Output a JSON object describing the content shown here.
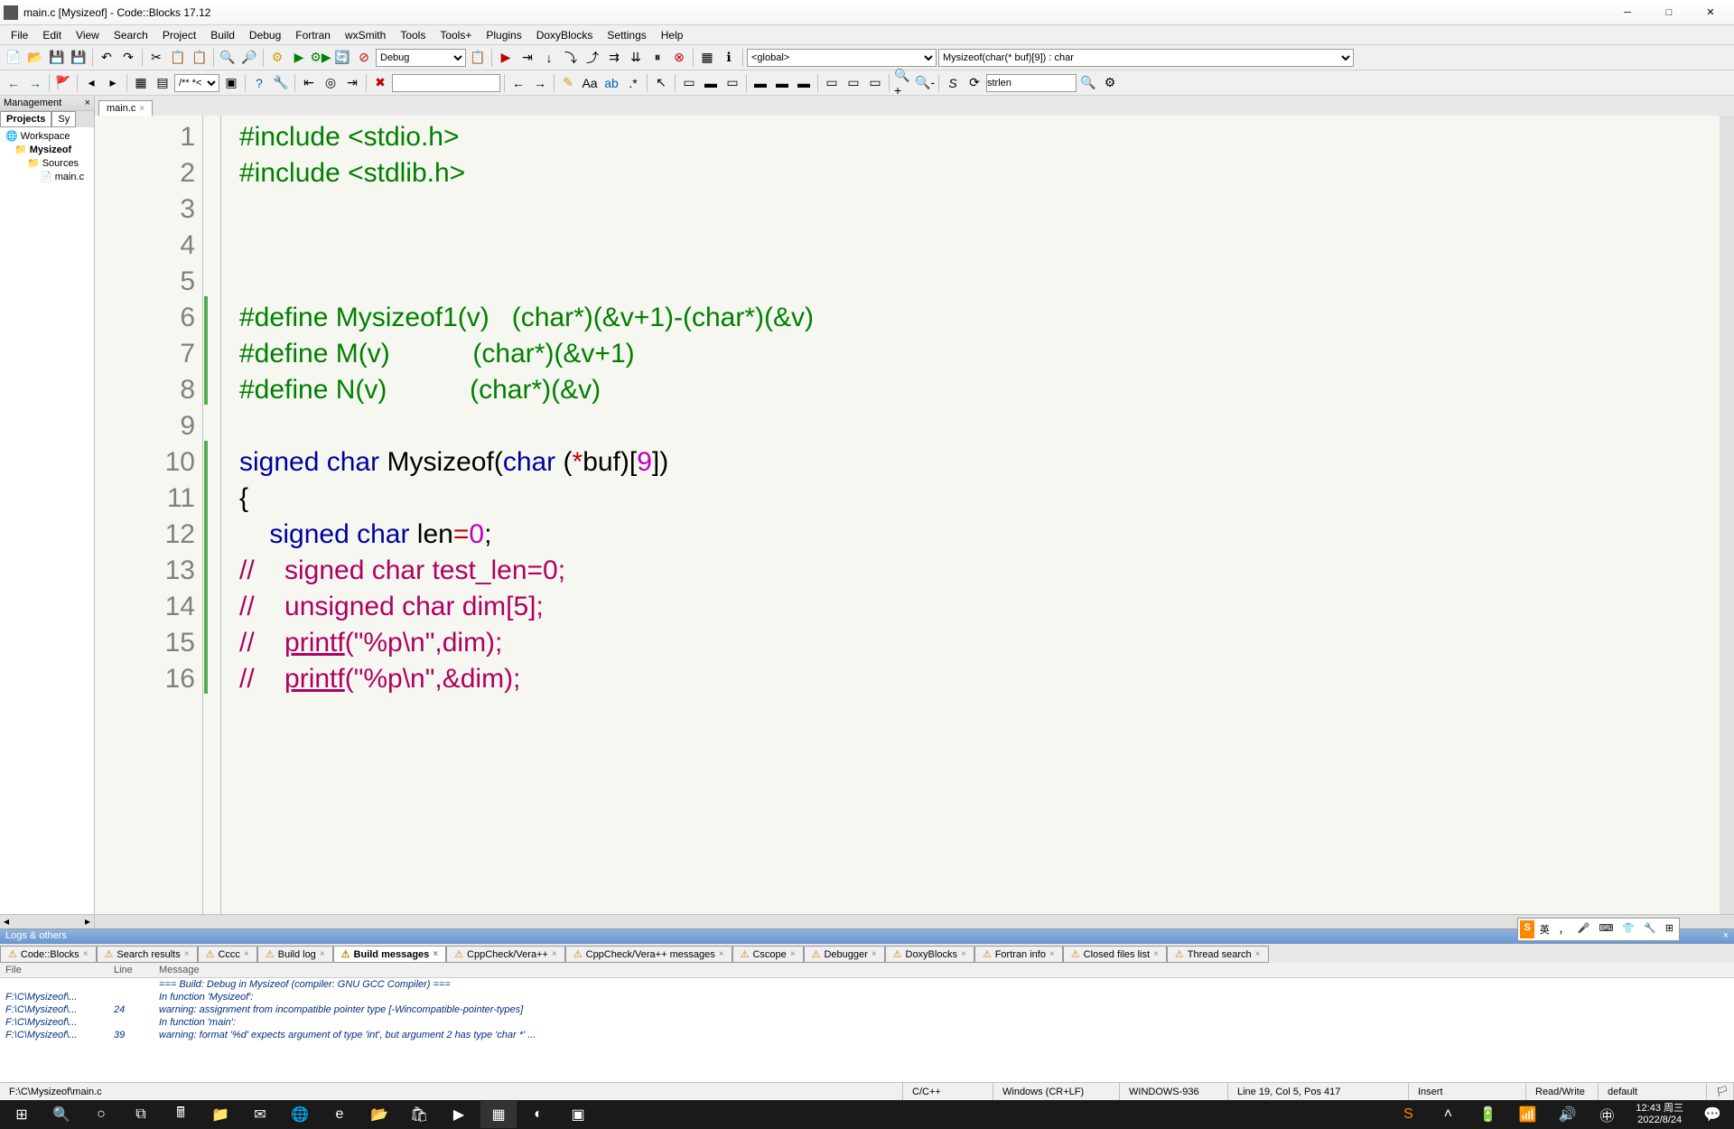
{
  "title": "main.c [Mysizeof] - Code::Blocks 17.12",
  "menu": [
    "File",
    "Edit",
    "View",
    "Search",
    "Project",
    "Build",
    "Debug",
    "Fortran",
    "wxSmith",
    "Tools",
    "Tools+",
    "Plugins",
    "DoxyBlocks",
    "Settings",
    "Help"
  ],
  "toolbar1": {
    "build_target": "Debug",
    "scope": "<global>",
    "symbol": "Mysizeof(char(* buf)[9]) : char"
  },
  "toolbar2": {
    "comment_style": "/**  *<",
    "search_term": "strlen"
  },
  "management": {
    "title": "Management",
    "tabs": [
      "Projects",
      "Sy"
    ],
    "tree": {
      "workspace": "Workspace",
      "project": "Mysizeof",
      "folder": "Sources",
      "file": "main.c"
    }
  },
  "editor_tab": "main.c",
  "code_lines": [
    {
      "n": 1,
      "html": "<span class='pp'>#include &lt;stdio.h&gt;</span>"
    },
    {
      "n": 2,
      "html": "<span class='pp'>#include &lt;stdlib.h&gt;</span>"
    },
    {
      "n": 3,
      "html": ""
    },
    {
      "n": 4,
      "html": ""
    },
    {
      "n": 5,
      "html": ""
    },
    {
      "n": 6,
      "html": "<span class='pp'>#define Mysizeof1(v)   (char*)(&v+1)-(char*)(&v)</span>"
    },
    {
      "n": 7,
      "html": "<span class='pp'>#define M(v)           (char*)(&v+1)</span>"
    },
    {
      "n": 8,
      "html": "<span class='pp'>#define N(v)           (char*)(&v)</span>"
    },
    {
      "n": 9,
      "html": ""
    },
    {
      "n": 10,
      "html": "<span class='kw'>signed</span> <span class='kw'>char</span> <span class='id'>Mysizeof</span>(<span class='kw'>char</span> (<span class='op'>*</span><span class='id'>buf</span>)[<span class='num'>9</span>])"
    },
    {
      "n": 11,
      "html": "{"
    },
    {
      "n": 12,
      "html": "    <span class='kw'>signed</span> <span class='kw'>char</span> <span class='id'>len</span><span class='op'>=</span><span class='num'>0</span>;"
    },
    {
      "n": 13,
      "html": "<span class='cmt'>//    signed char test_len=0;</span>"
    },
    {
      "n": 14,
      "html": "<span class='cmt'>//    unsigned char dim[5];</span>"
    },
    {
      "n": 15,
      "html": "<span class='cmt'>//    <u>printf</u>(\"%p\\n\",dim);</span>"
    },
    {
      "n": 16,
      "html": "<span class='cmt'>//    <u>printf</u>(\"%p\\n\",&dim);</span>"
    }
  ],
  "logs": {
    "title": "Logs & others",
    "tabs": [
      "Code::Blocks",
      "Search results",
      "Cccc",
      "Build log",
      "Build messages",
      "CppCheck/Vera++",
      "CppCheck/Vera++ messages",
      "Cscope",
      "Debugger",
      "DoxyBlocks",
      "Fortran info",
      "Closed files list",
      "Thread search"
    ],
    "active_tab": 4,
    "headers": [
      "File",
      "Line",
      "Message"
    ],
    "rows": [
      {
        "file": "",
        "line": "",
        "msg": "=== Build: Debug in Mysizeof (compiler: GNU GCC Compiler) ==="
      },
      {
        "file": "F:\\C\\Mysizeof\\...",
        "line": "",
        "msg": "In function 'Mysizeof':"
      },
      {
        "file": "F:\\C\\Mysizeof\\...",
        "line": "24",
        "msg": "warning: assignment from incompatible pointer type [-Wincompatible-pointer-types]"
      },
      {
        "file": "F:\\C\\Mysizeof\\...",
        "line": "",
        "msg": "In function 'main':"
      },
      {
        "file": "F:\\C\\Mysizeof\\...",
        "line": "39",
        "msg": "warning: format '%d' expects argument of type 'int', but argument 2 has type 'char *' ..."
      }
    ]
  },
  "status": {
    "path": "F:\\C\\Mysizeof\\main.c",
    "lang": "C/C++",
    "eol": "Windows (CR+LF)",
    "enc": "WINDOWS-936",
    "pos": "Line 19, Col 5, Pos 417",
    "ins": "Insert",
    "rw": "Read/Write",
    "profile": "default"
  },
  "clock": {
    "time": "12:43",
    "date": "2022/8/24",
    "day": "周三"
  },
  "ime": {
    "brand": "S",
    "lang": "英"
  }
}
